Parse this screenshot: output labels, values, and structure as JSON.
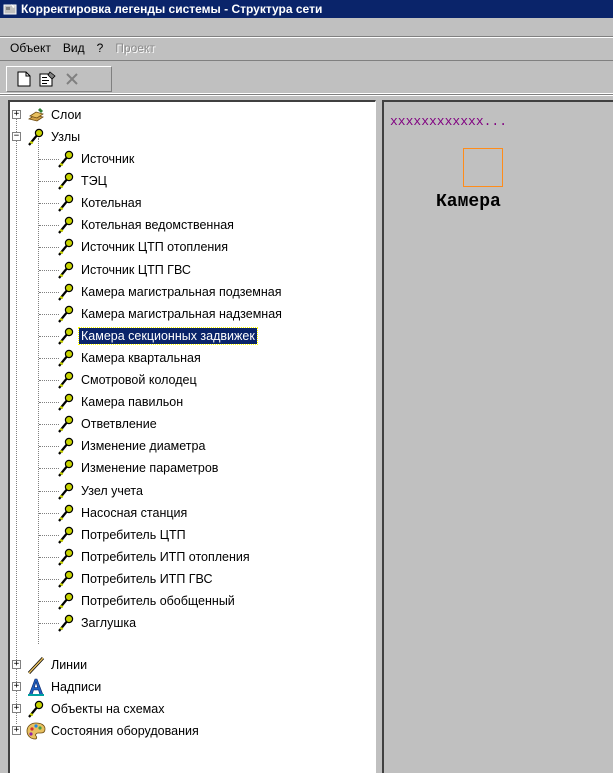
{
  "window": {
    "title": "Корректировка легенды системы - Структура сети"
  },
  "menubar": {
    "items": [
      {
        "label": "Объект",
        "disabled": false
      },
      {
        "label": "Вид",
        "disabled": false
      },
      {
        "label": "?",
        "disabled": false
      },
      {
        "label": "Проект",
        "disabled": true
      }
    ]
  },
  "toolbar": {
    "buttons": [
      {
        "name": "new-document-icon",
        "enabled": true
      },
      {
        "name": "properties-icon",
        "enabled": true
      },
      {
        "name": "delete-icon",
        "enabled": false
      }
    ]
  },
  "tree": {
    "roots": [
      {
        "label": "Слои",
        "icon": "layers-icon",
        "expanded": false
      },
      {
        "label": "Узлы",
        "icon": "node-icon",
        "expanded": true,
        "children": [
          "Источник",
          "ТЭЦ",
          "Котельная",
          "Котельная ведомственная",
          "Источник ЦТП отопления",
          "Источник ЦТП ГВС",
          "Камера магистральная подземная",
          "Камера магистральная надземная",
          "Камера секционных задвижек",
          "Камера квартальная",
          "Смотровой колодец",
          "Камера павильон",
          "Ответвление",
          "Изменение диаметра",
          "Изменение параметров",
          "Узел учета",
          "Насосная станция",
          "Потребитель ЦТП",
          "Потребитель ИТП отопления",
          "Потребитель ИТП ГВС",
          "Потребитель обобщенный",
          "Заглушка"
        ],
        "selected_child": "Камера секционных задвижек"
      },
      {
        "label": "Линии",
        "icon": "line-icon",
        "expanded": false
      },
      {
        "label": "Надписи",
        "icon": "text-label-icon",
        "expanded": false
      },
      {
        "label": "Объекты на схемах",
        "icon": "node-icon",
        "expanded": false
      },
      {
        "label": "Состояния оборудования",
        "icon": "palette-icon",
        "expanded": false
      }
    ]
  },
  "preview": {
    "sample_text": "xxxxxxxxxxxx...",
    "label": "Камера",
    "square_color": "#ff8c1a",
    "sample_text_color": "#800080"
  },
  "colors": {
    "titlebar": "#0a246a",
    "selection": "#0a246a",
    "face": "#c0c0c0"
  }
}
